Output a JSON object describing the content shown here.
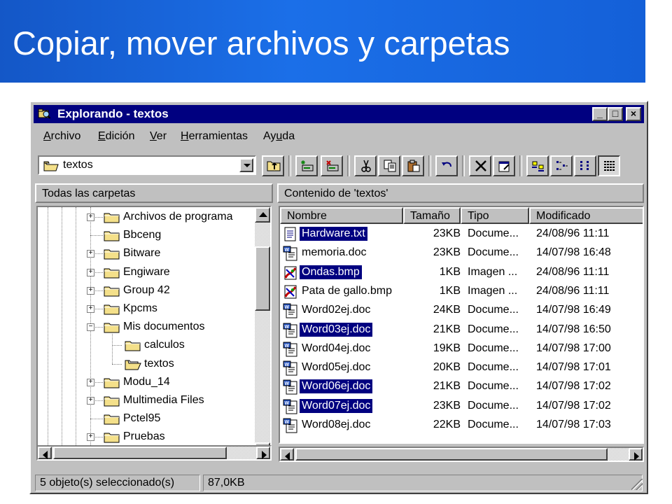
{
  "slide": {
    "title": "Copiar, mover archivos y carpetas",
    "banner_color": "#1b6fe8"
  },
  "window": {
    "title": "Explorando - textos",
    "title_bar_color": "#000080",
    "controls": {
      "minimize": "_",
      "maximize": "□",
      "close": "×"
    }
  },
  "menu": [
    "Archivo",
    "Edición",
    "Ver",
    "Herramientas",
    "Ayuda"
  ],
  "address": {
    "value": "textos"
  },
  "toolbar_icons": [
    "up-folder-icon",
    "map-drive-icon",
    "disconnect-drive-icon",
    "cut-icon",
    "copy-icon",
    "paste-icon",
    "undo-icon",
    "delete-icon",
    "properties-icon",
    "large-icons-view-icon",
    "small-icons-view-icon",
    "list-view-icon",
    "details-view-icon"
  ],
  "left_pane": {
    "header": "Todas las carpetas",
    "items": [
      {
        "label": "Archivos de programa",
        "expandable": true
      },
      {
        "label": "Bbceng",
        "expandable": false
      },
      {
        "label": "Bitware",
        "expandable": true
      },
      {
        "label": "Engiware",
        "expandable": true
      },
      {
        "label": "Group 42",
        "expandable": true
      },
      {
        "label": "Kpcms",
        "expandable": true
      },
      {
        "label": "Mis documentos",
        "expandable": true,
        "expanded": true
      },
      {
        "label": "calculos",
        "expandable": false,
        "child": true
      },
      {
        "label": "textos",
        "expandable": false,
        "child": true,
        "open": true
      },
      {
        "label": "Modu_14",
        "expandable": true
      },
      {
        "label": "Multimedia Files",
        "expandable": true
      },
      {
        "label": "Pctel95",
        "expandable": false
      },
      {
        "label": "Pruebas",
        "expandable": true
      }
    ]
  },
  "right_pane": {
    "header": "Contenido de 'textos'",
    "columns": {
      "name": "Nombre",
      "size": "Tamaño",
      "type": "Tipo",
      "modified": "Modificado"
    },
    "files": [
      {
        "name": "Hardware.txt",
        "size": "23KB",
        "type": "Docume...",
        "modified": "24/08/96 11:11",
        "selected": true,
        "icon": "text-file-icon"
      },
      {
        "name": "memoria.doc",
        "size": "23KB",
        "type": "Docume...",
        "modified": "14/07/98 16:48",
        "selected": false,
        "icon": "word-doc-icon"
      },
      {
        "name": "Ondas.bmp",
        "size": "1KB",
        "type": "Imagen ...",
        "modified": "24/08/96 11:11",
        "selected": true,
        "icon": "bitmap-icon"
      },
      {
        "name": "Pata de gallo.bmp",
        "size": "1KB",
        "type": "Imagen ...",
        "modified": "24/08/96 11:11",
        "selected": false,
        "icon": "bitmap-icon"
      },
      {
        "name": "Word02ej.doc",
        "size": "24KB",
        "type": "Docume...",
        "modified": "14/07/98 16:49",
        "selected": false,
        "icon": "word-doc-icon"
      },
      {
        "name": "Word03ej.doc",
        "size": "21KB",
        "type": "Docume...",
        "modified": "14/07/98 16:50",
        "selected": true,
        "icon": "word-doc-icon"
      },
      {
        "name": "Word04ej.doc",
        "size": "19KB",
        "type": "Docume...",
        "modified": "14/07/98 17:00",
        "selected": false,
        "icon": "word-doc-icon"
      },
      {
        "name": "Word05ej.doc",
        "size": "20KB",
        "type": "Docume...",
        "modified": "14/07/98 17:01",
        "selected": false,
        "icon": "word-doc-icon"
      },
      {
        "name": "Word06ej.doc",
        "size": "21KB",
        "type": "Docume...",
        "modified": "14/07/98 17:02",
        "selected": true,
        "icon": "word-doc-icon"
      },
      {
        "name": "Word07ej.doc",
        "size": "23KB",
        "type": "Docume...",
        "modified": "14/07/98 17:02",
        "selected": true,
        "icon": "word-doc-icon"
      },
      {
        "name": "Word08ej.doc",
        "size": "22KB",
        "type": "Docume...",
        "modified": "14/07/98 17:03",
        "selected": false,
        "icon": "word-doc-icon"
      }
    ]
  },
  "status": {
    "selection": "5 objeto(s) seleccionado(s)",
    "size": "87,0KB"
  }
}
